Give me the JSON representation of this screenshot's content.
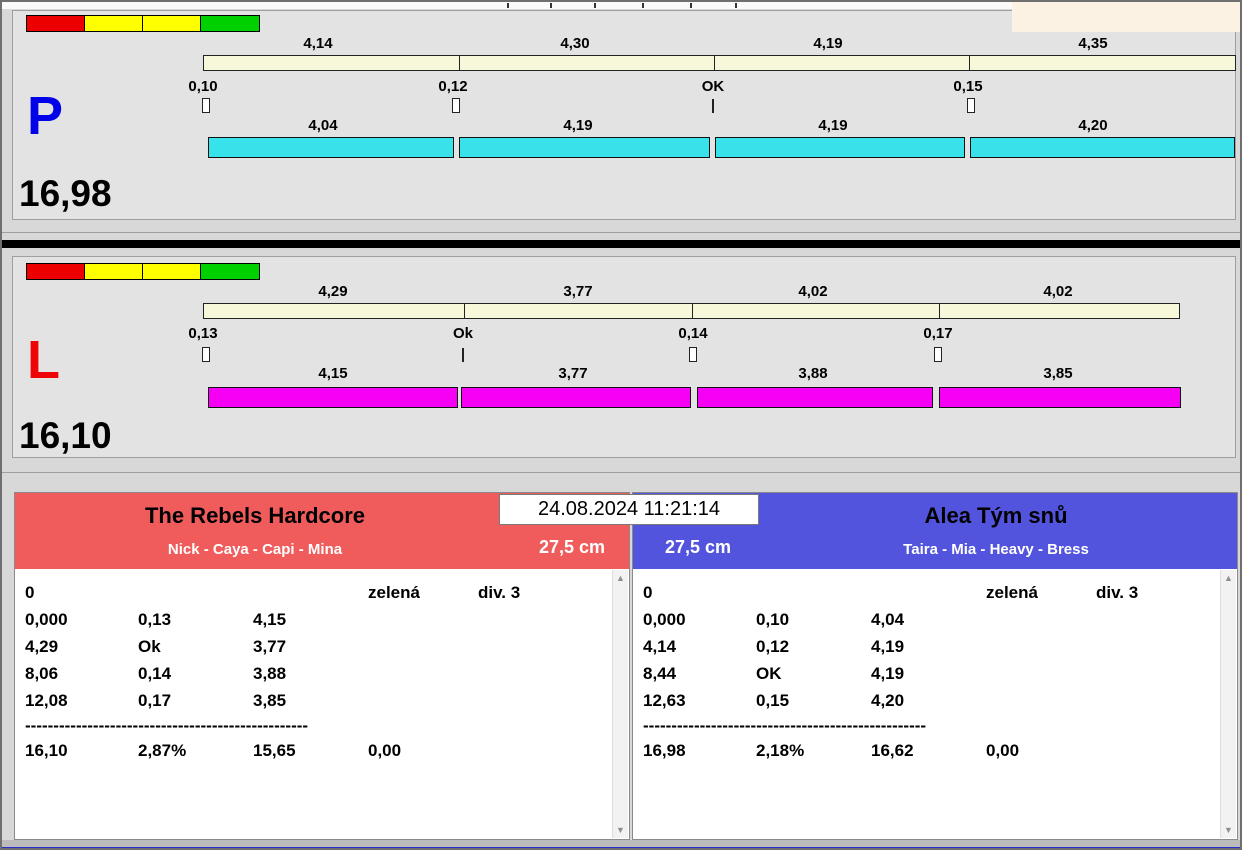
{
  "datetime": "24.08.2024 11:21:14",
  "colors": {
    "lane_p_bar": "#38e2ea",
    "lane_l_bar": "#f500f5",
    "split_bar": "#f7f7da",
    "team_left_header": "#f05c5c",
    "team_right_header": "#5354dd",
    "lane_p_letter": "#0202e8",
    "lane_l_letter": "#ee0404",
    "status_red": "#ec0000",
    "status_yellow": "#ffff00",
    "status_green": "#00cf00"
  },
  "lanes": [
    {
      "letter": "P",
      "total": "16,98",
      "splits": [
        "4,14",
        "4,30",
        "4,19",
        "4,35"
      ],
      "exchanges": [
        "0,10",
        "0,12",
        "OK",
        "0,15"
      ],
      "legs": [
        "4,04",
        "4,19",
        "4,19",
        "4,20"
      ]
    },
    {
      "letter": "L",
      "total": "16,10",
      "splits": [
        "4,29",
        "3,77",
        "4,02",
        "4,02"
      ],
      "exchanges": [
        "0,13",
        "Ok",
        "0,14",
        "0,17"
      ],
      "legs": [
        "4,15",
        "3,77",
        "3,88",
        "3,85"
      ]
    }
  ],
  "teams": [
    {
      "name": "The Rebels Hardcore",
      "members": "Nick - Caya - Capi - Mina",
      "jump_height": "27,5 cm",
      "run_no": "0",
      "card": "zelená",
      "division": "div. 3",
      "rows": [
        [
          "0,000",
          "0,13",
          "4,15"
        ],
        [
          "4,29",
          "Ok",
          "3,77"
        ],
        [
          "8,06",
          "0,14",
          "3,88"
        ],
        [
          "12,08",
          "0,17",
          "3,85"
        ]
      ],
      "divider": "--------------------------------------------------",
      "summary": [
        "16,10",
        "2,87%",
        "15,65",
        "0,00"
      ]
    },
    {
      "name": "Alea Tým snů",
      "members": "Taira - Mia - Heavy - Bress",
      "jump_height": "27,5 cm",
      "run_no": "0",
      "card": "zelená",
      "division": "div. 3",
      "rows": [
        [
          "0,000",
          "0,10",
          "4,04"
        ],
        [
          "4,14",
          "0,12",
          "4,19"
        ],
        [
          "8,44",
          "OK",
          "4,19"
        ],
        [
          "12,63",
          "0,15",
          "4,20"
        ]
      ],
      "divider": "--------------------------------------------------",
      "summary": [
        "16,98",
        "2,18%",
        "16,62",
        "0,00"
      ]
    }
  ]
}
